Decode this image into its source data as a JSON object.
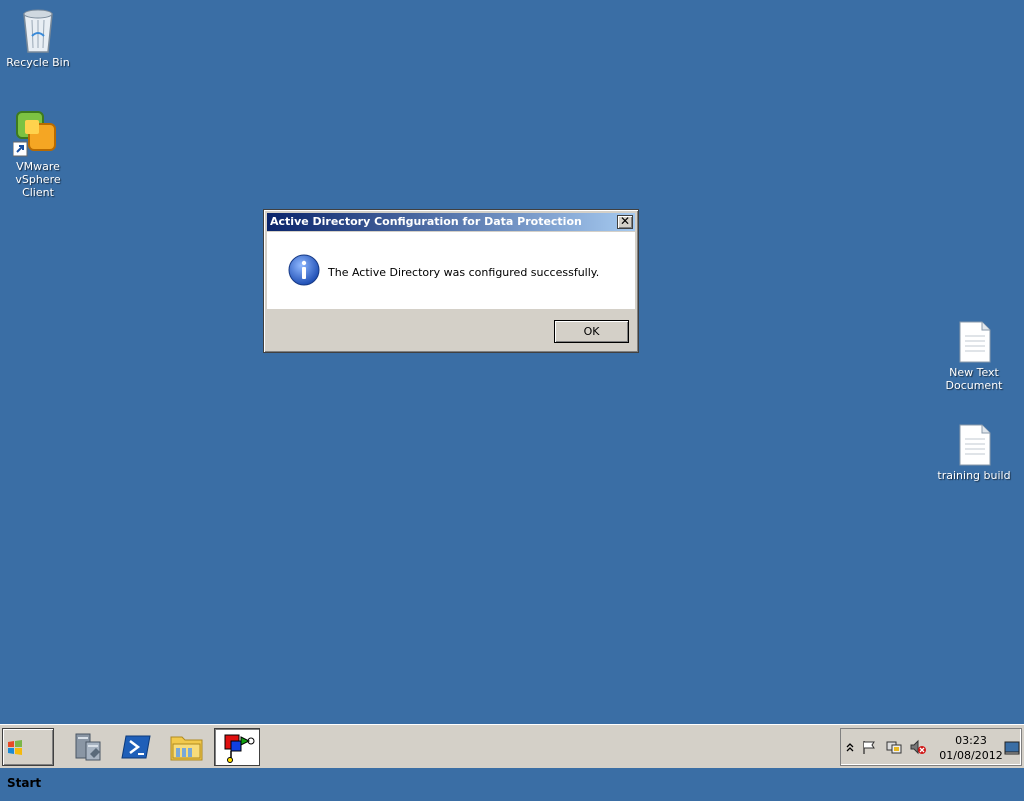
{
  "desktop": {
    "icons": [
      {
        "label": "Recycle Bin"
      },
      {
        "label": "VMware vSphere Client"
      },
      {
        "label": "New Text Document"
      },
      {
        "label": "training build"
      }
    ]
  },
  "dialog": {
    "title": "Active Directory Configuration for Data Protection Manager",
    "message": "The Active Directory was configured successfully.",
    "ok_label": "OK",
    "close_glyph": "✕",
    "icon": "info-icon"
  },
  "taskbar": {
    "start_label": "Start",
    "apps": [
      "server-manager-icon",
      "powershell-icon",
      "explorer-icon",
      "dpm-setup-icon"
    ],
    "tray_icons": [
      "show-hidden-icons-chevron",
      "action-center-flag-icon",
      "network-icon",
      "volume-muted-icon",
      "show-desktop-icon"
    ],
    "time": "03:23",
    "date": "01/08/2012"
  },
  "colors": {
    "desktop": "#3a6ea5",
    "titlebar_start": "#0a246a",
    "titlebar_end": "#a6caf0",
    "chrome": "#d4d0c8"
  }
}
